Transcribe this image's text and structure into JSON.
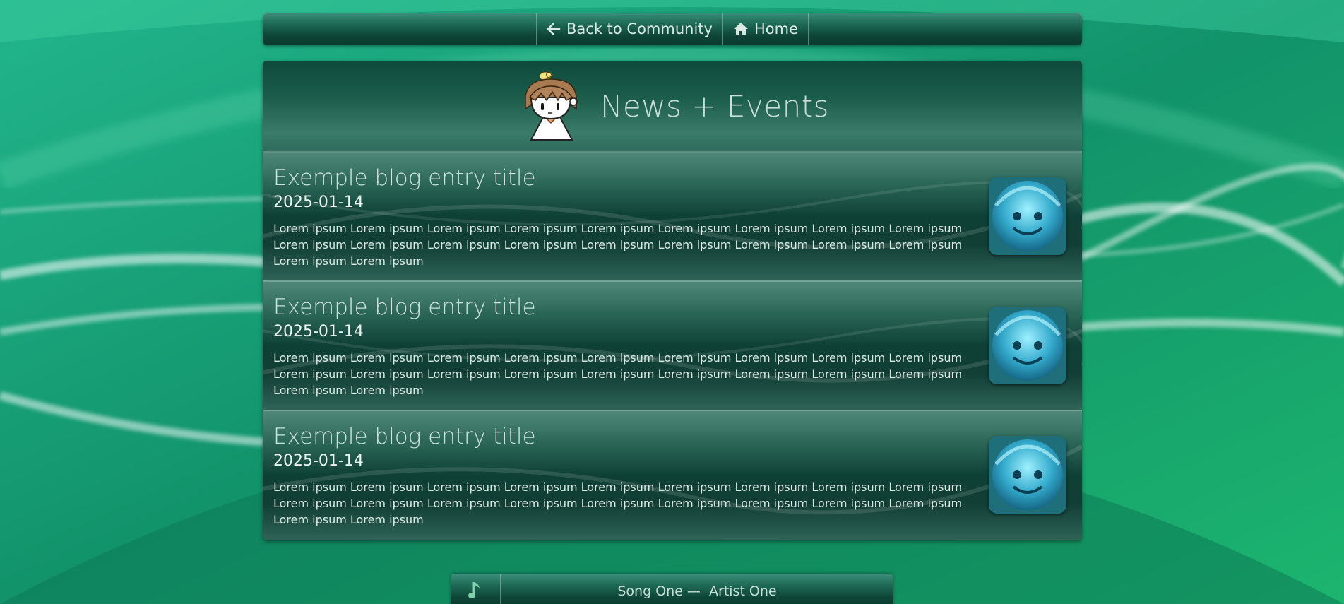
{
  "nav": {
    "back_label": "Back to Community",
    "home_label": "Home"
  },
  "header": {
    "title": "News + Events"
  },
  "entries": [
    {
      "title": "Exemple blog entry title",
      "date": "2025-01-14",
      "body": "Lorem ipsum Lorem ipsum Lorem ipsum Lorem ipsum Lorem ipsum Lorem ipsum Lorem ipsum Lorem ipsum Lorem ipsum Lorem ipsum Lorem ipsum Lorem ipsum Lorem ipsum Lorem ipsum Lorem ipsum Lorem ipsum Lorem ipsum Lorem ipsum Lorem ipsum Lorem ipsum"
    },
    {
      "title": "Exemple blog entry title",
      "date": "2025-01-14",
      "body": "Lorem ipsum Lorem ipsum Lorem ipsum Lorem ipsum Lorem ipsum Lorem ipsum Lorem ipsum Lorem ipsum Lorem ipsum Lorem ipsum Lorem ipsum Lorem ipsum Lorem ipsum Lorem ipsum Lorem ipsum Lorem ipsum Lorem ipsum Lorem ipsum Lorem ipsum Lorem ipsum"
    },
    {
      "title": "Exemple blog entry title",
      "date": "2025-01-14",
      "body": "Lorem ipsum Lorem ipsum Lorem ipsum Lorem ipsum Lorem ipsum Lorem ipsum Lorem ipsum Lorem ipsum Lorem ipsum Lorem ipsum Lorem ipsum Lorem ipsum Lorem ipsum Lorem ipsum Lorem ipsum Lorem ipsum Lorem ipsum Lorem ipsum Lorem ipsum Lorem ipsum"
    }
  ],
  "player": {
    "track_label": "Song One —  Artist One"
  },
  "colors": {
    "background": "#14996f",
    "panel_dark": "#0e4035",
    "text_light": "#cfe1da"
  },
  "icons": [
    "arrow-left-icon",
    "home-icon",
    "music-note-icon"
  ]
}
